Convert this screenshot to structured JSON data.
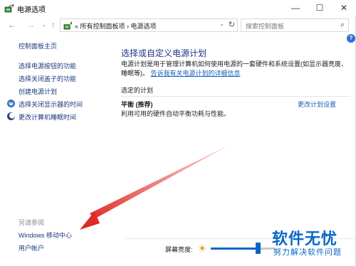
{
  "window": {
    "title": "电源选项",
    "controls": {
      "minimize": "—",
      "maximize": "☐",
      "close": "✕"
    }
  },
  "nav": {
    "back": "←",
    "forward": "→",
    "dropdown": "⌄",
    "up": "↑",
    "breadcrumb_prefix": "«",
    "breadcrumb": [
      "所有控制面板项",
      "电源选项"
    ],
    "breadcrumb_sep": "›",
    "address_text": "«  所有控制面板项  ›  电源选项",
    "address_dropdown": "⌄",
    "refresh": "↻",
    "search_placeholder": "搜索控制面板",
    "search_icon": "⌕"
  },
  "help": "?",
  "sidebar": {
    "home": "控制面板主页",
    "items": [
      {
        "label": "选择电源按钮的功能",
        "icon": null
      },
      {
        "label": "选择关闭盖子的功能",
        "icon": null
      },
      {
        "label": "创建电源计划",
        "icon": null
      },
      {
        "label": "选择关闭显示器的时间",
        "icon": "display-icon"
      },
      {
        "label": "更改计算机睡眠时间",
        "icon": "moon-icon"
      }
    ],
    "see_also_title": "另请参阅",
    "see_also": [
      "Windows 移动中心",
      "用户帐户"
    ]
  },
  "main": {
    "title": "选择或自定义电源计划",
    "description": "电源计划是用于管理计算机如何使用电源的一套硬件和系统设置(如显示器亮度、睡眠等)。",
    "description_link": "告诉我有关电源计划的详细信息",
    "section_title": "选定的计划",
    "plan": {
      "name": "平衡 (推荐)",
      "desc": "利用可用的硬件自动平衡功耗与性能。",
      "change_link": "更改计划设置"
    }
  },
  "brightness": {
    "label": "屏幕亮度:",
    "value": 0.73
  },
  "watermark": {
    "logo": "软件无忧",
    "sub": "努力解决软件问题"
  },
  "colors": {
    "link": "#1a3a7a",
    "title": "#1e3287",
    "accent": "#0a64c4",
    "arrow": "#e02a25"
  }
}
